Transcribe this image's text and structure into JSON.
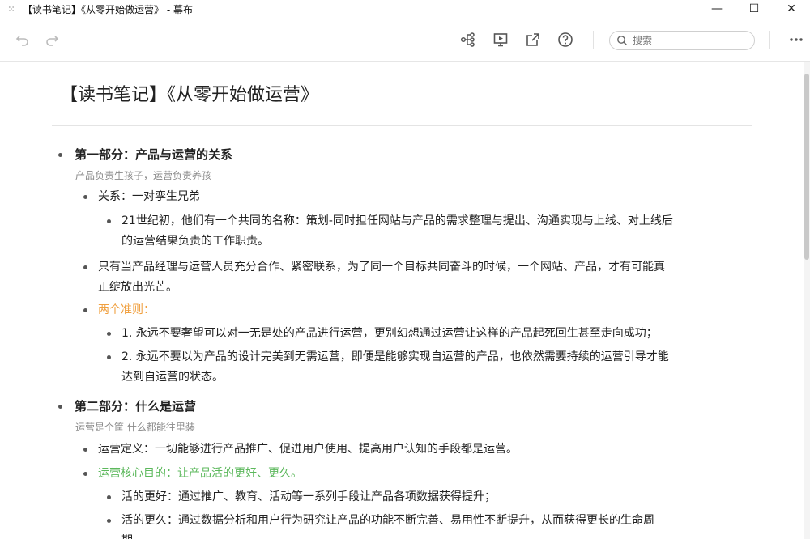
{
  "window": {
    "title": "【读书笔记】《从零开始做运营》 - 幕布",
    "app_icon": "mubu-app-icon",
    "controls": {
      "minimize": "—",
      "maximize": "☐",
      "close": "✕"
    }
  },
  "toolbar": {
    "icons": [
      "undo-icon",
      "redo-icon",
      "mindmap-icon",
      "presentation-icon",
      "share-icon",
      "help-icon",
      "more-icon"
    ],
    "search_placeholder": "搜索"
  },
  "document": {
    "title": "【读书笔记】《从零开始做运营》",
    "sections": [
      {
        "heading": "第一部分：产品与运营的关系",
        "note": "产品负责生孩子，运营负责养孩",
        "items": [
          {
            "text": "关系：一对孪生兄弟",
            "children": [
              {
                "line1": "21世纪初，他们有一个共同的名称：策划-同时担任网站与产品的需求整理与提出、沟通实现与上线、对上线后",
                "line2": "的运营结果负责的工作职责。"
              }
            ]
          },
          {
            "line1": "只有当产品经理与运营人员充分合作、紧密联系，为了同一个目标共同奋斗的时候，一个网站、产品，才有可能真",
            "line2": "正绽放出光芒。"
          },
          {
            "text": "两个准则：",
            "color": "#f0a040",
            "children": [
              {
                "text": "1. 永远不要奢望可以对一无是处的产品进行运营，更别幻想通过运营让这样的产品起死回生甚至走向成功；"
              },
              {
                "line1": "2. 永远不要以为产品的设计完美到无需运营，即便是能够实现自运营的产品，也依然需要持续的运营引导才能",
                "line2": "达到自运营的状态。"
              }
            ]
          }
        ]
      },
      {
        "heading": "第二部分：什么是运营",
        "note": "运营是个筐 什么都能往里装",
        "items": [
          {
            "text": "运营定义：一切能够进行产品推广、促进用户使用、提高用户认知的手段都是运营。"
          },
          {
            "text": "运营核心目的：让产品活的更好、更久。",
            "color": "#5cb85c",
            "children": [
              {
                "text": "活的更好：通过推广、教育、活动等一系列手段让产品各项数据获得提升；"
              },
              {
                "line1": "活的更久：通过数据分析和用户行为研究让产品的功能不断完善、易用性不断提升，从而获得更长的生命周",
                "line2": "期。"
              }
            ]
          }
        ]
      }
    ]
  }
}
